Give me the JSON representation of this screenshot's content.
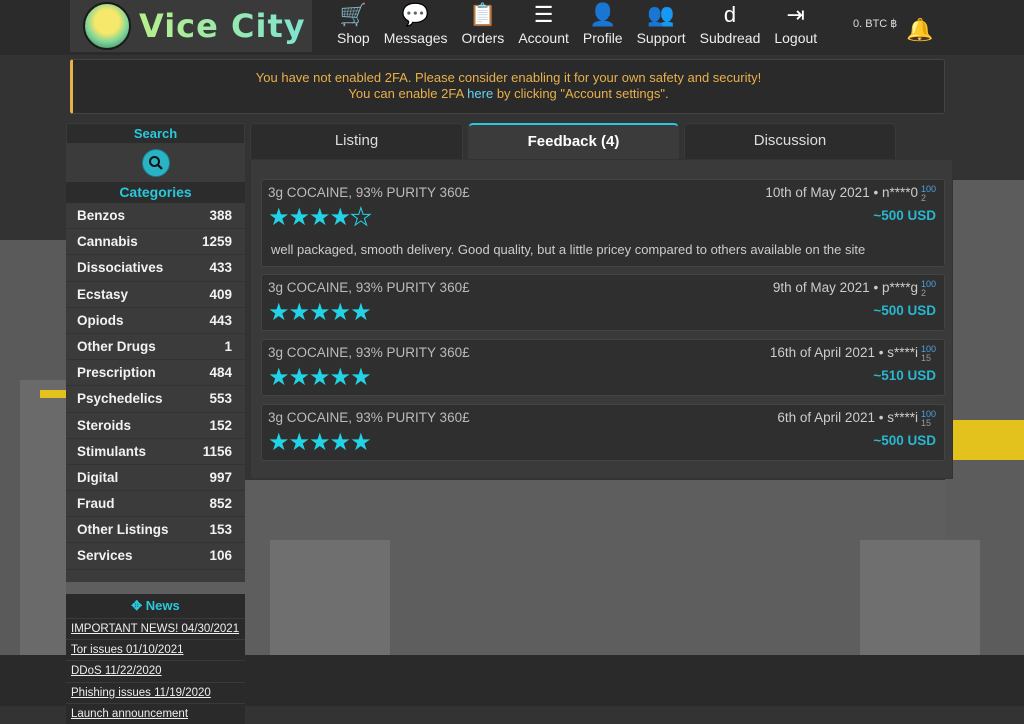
{
  "brand": {
    "logo_text": "Vice City"
  },
  "nav": [
    {
      "label": "Shop",
      "icon": "shopping-cart-icon",
      "glyph": "🛒"
    },
    {
      "label": "Messages",
      "icon": "messages-icon",
      "glyph": "💬"
    },
    {
      "label": "Orders",
      "icon": "orders-icon",
      "glyph": "📋"
    },
    {
      "label": "Account",
      "icon": "account-menu-icon",
      "glyph": "☰"
    },
    {
      "label": "Profile",
      "icon": "profile-icon",
      "glyph": "👤"
    },
    {
      "label": "Support",
      "icon": "support-icon",
      "glyph": "👥"
    },
    {
      "label": "Subdread",
      "icon": "subdread-icon",
      "glyph": "d"
    },
    {
      "label": "Logout",
      "icon": "logout-icon",
      "glyph": "⇥"
    }
  ],
  "wallet": {
    "balance": "0. BTC ฿"
  },
  "alert": {
    "line1": "You have not enabled 2FA. Please consider enabling it for your own safety and security!",
    "line2_pre": "You can enable 2FA ",
    "line2_link": "here",
    "line2_post": " by clicking \"Account settings\"."
  },
  "sidebar": {
    "search_title": "Search",
    "categories_title": "Categories",
    "categories": [
      {
        "name": "Benzos",
        "count": "388"
      },
      {
        "name": "Cannabis",
        "count": "1259"
      },
      {
        "name": "Dissociatives",
        "count": "433"
      },
      {
        "name": "Ecstasy",
        "count": "409"
      },
      {
        "name": "Opiods",
        "count": "443"
      },
      {
        "name": "Other Drugs",
        "count": "1"
      },
      {
        "name": "Prescription",
        "count": "484"
      },
      {
        "name": "Psychedelics",
        "count": "553"
      },
      {
        "name": "Steroids",
        "count": "152"
      },
      {
        "name": "Stimulants",
        "count": "1156"
      },
      {
        "name": "Digital",
        "count": "997"
      },
      {
        "name": "Fraud",
        "count": "852"
      },
      {
        "name": "Other Listings",
        "count": "153"
      },
      {
        "name": "Services",
        "count": "106"
      }
    ],
    "news_title": "News",
    "news": [
      "IMPORTANT NEWS! 04/30/2021",
      "Tor issues 01/10/2021",
      "DDoS 11/22/2020",
      "Phishing issues 11/19/2020",
      "Launch announcement"
    ]
  },
  "tabs": [
    {
      "label": "Listing",
      "active": false
    },
    {
      "label": "Feedback (4)",
      "active": true
    },
    {
      "label": "Discussion",
      "active": false
    }
  ],
  "reviews": [
    {
      "title": "3g COCAINE, 93% PURITY 360£",
      "date": "10th of May 2021",
      "user": "n****0",
      "rep_top": "100",
      "rep_bottom": "2",
      "rating": 4,
      "usd": "~500 USD",
      "text": "well packaged, smooth delivery. Good quality, but a little pricey compared to others available on the site"
    },
    {
      "title": "3g COCAINE, 93% PURITY 360£",
      "date": "9th of May 2021",
      "user": "p****g",
      "rep_top": "100",
      "rep_bottom": "2",
      "rating": 5,
      "usd": "~500 USD",
      "text": ""
    },
    {
      "title": "3g COCAINE, 93% PURITY 360£",
      "date": "16th of April 2021",
      "user": "s****i",
      "rep_top": "100",
      "rep_bottom": "15",
      "rating": 5,
      "usd": "~510 USD",
      "text": ""
    },
    {
      "title": "3g COCAINE, 93% PURITY 360£",
      "date": "6th of April 2021",
      "user": "s****i",
      "rep_top": "100",
      "rep_bottom": "15",
      "rating": 5,
      "usd": "~500 USD",
      "text": ""
    }
  ],
  "colors": {
    "accent": "#28c9dd",
    "star": "#22d3e6",
    "warning": "#e8b04a"
  }
}
